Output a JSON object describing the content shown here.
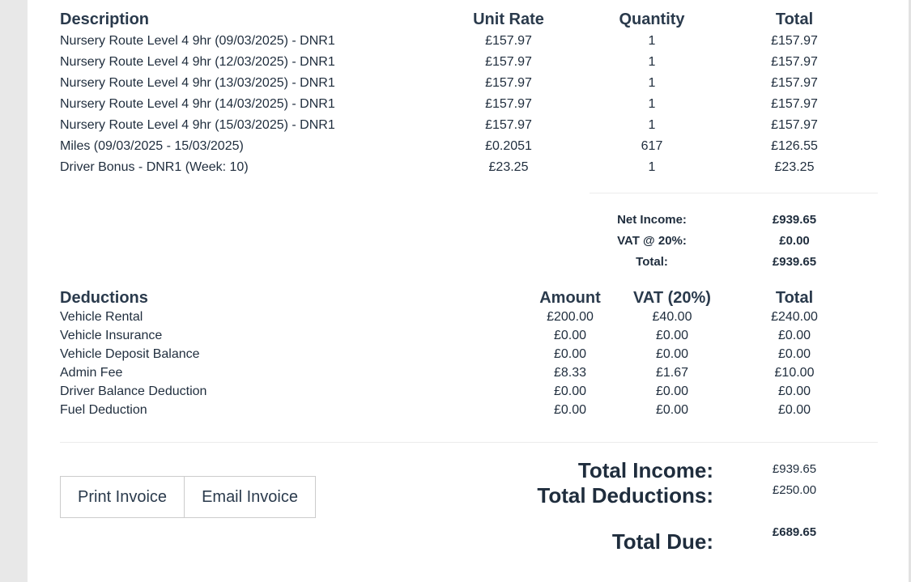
{
  "income": {
    "headers": {
      "description": "Description",
      "unit_rate": "Unit Rate",
      "quantity": "Quantity",
      "total": "Total"
    },
    "rows": [
      {
        "description": "Nursery Route Level 4 9hr (09/03/2025) - DNR1",
        "unit_rate": "£157.97",
        "quantity": "1",
        "total": "£157.97"
      },
      {
        "description": "Nursery Route Level 4 9hr (12/03/2025) - DNR1",
        "unit_rate": "£157.97",
        "quantity": "1",
        "total": "£157.97"
      },
      {
        "description": "Nursery Route Level 4 9hr (13/03/2025) - DNR1",
        "unit_rate": "£157.97",
        "quantity": "1",
        "total": "£157.97"
      },
      {
        "description": "Nursery Route Level 4 9hr (14/03/2025) - DNR1",
        "unit_rate": "£157.97",
        "quantity": "1",
        "total": "£157.97"
      },
      {
        "description": "Nursery Route Level 4 9hr (15/03/2025) - DNR1",
        "unit_rate": "£157.97",
        "quantity": "1",
        "total": "£157.97"
      },
      {
        "description": "Miles (09/03/2025 - 15/03/2025)",
        "unit_rate": "£0.2051",
        "quantity": "617",
        "total": "£126.55"
      },
      {
        "description": "Driver Bonus - DNR1 (Week: 10)",
        "unit_rate": "£23.25",
        "quantity": "1",
        "total": "£23.25"
      }
    ],
    "summary": {
      "net_income_label": "Net Income:",
      "net_income_value": "£939.65",
      "vat_label": "VAT @ 20%:",
      "vat_value": "£0.00",
      "total_label": "Total:",
      "total_value": "£939.65"
    }
  },
  "deductions": {
    "headers": {
      "description": "Deductions",
      "amount": "Amount",
      "vat": "VAT (20%)",
      "total": "Total"
    },
    "rows": [
      {
        "description": "Vehicle Rental",
        "amount": "£200.00",
        "vat": "£40.00",
        "total": "£240.00"
      },
      {
        "description": "Vehicle Insurance",
        "amount": "£0.00",
        "vat": "£0.00",
        "total": "£0.00"
      },
      {
        "description": "Vehicle Deposit Balance",
        "amount": "£0.00",
        "vat": "£0.00",
        "total": "£0.00"
      },
      {
        "description": "Admin Fee",
        "amount": "£8.33",
        "vat": "£1.67",
        "total": "£10.00"
      },
      {
        "description": "Driver Balance Deduction",
        "amount": "£0.00",
        "vat": "£0.00",
        "total": "£0.00"
      },
      {
        "description": "Fuel Deduction",
        "amount": "£0.00",
        "vat": "£0.00",
        "total": "£0.00"
      }
    ]
  },
  "buttons": {
    "print_label": "Print Invoice",
    "email_label": "Email Invoice"
  },
  "totals": {
    "income_label": "Total Income:",
    "income_value": "£939.65",
    "deductions_label": "Total Deductions:",
    "deductions_value": "£250.00",
    "due_label": "Total Due:",
    "due_value": "£689.65"
  }
}
